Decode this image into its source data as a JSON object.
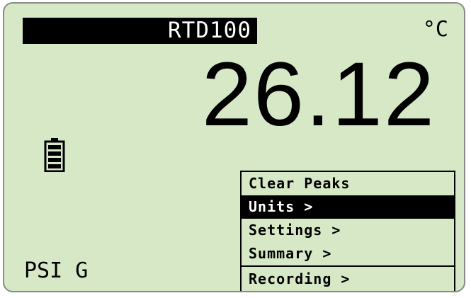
{
  "display": {
    "channel_label": "RTD100",
    "unit": "°C",
    "reading": "26.12",
    "pressure_mode": "PSI G",
    "battery_icon": "battery-icon"
  },
  "menu": {
    "items": [
      {
        "label": "Clear Peaks"
      },
      {
        "label": "Units >"
      },
      {
        "label": "Settings >"
      },
      {
        "label": "Summary >"
      },
      {
        "label": "Recording >"
      }
    ],
    "selected_index": 1
  },
  "colors": {
    "lcd_background": "#d7e8c6",
    "foreground": "#000000",
    "inverse_text": "#ffffff"
  }
}
